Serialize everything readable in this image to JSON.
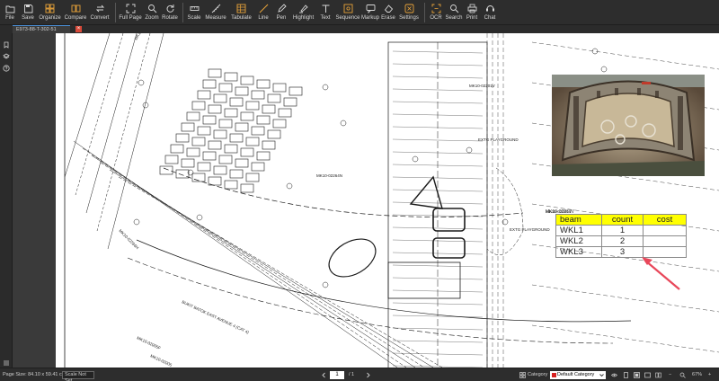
{
  "toolbar": {
    "items": [
      {
        "label": "File",
        "icon": "folder-icon"
      },
      {
        "label": "Save",
        "icon": "save-icon"
      },
      {
        "label": "Organize",
        "icon": "organize-icon"
      },
      {
        "label": "Compare",
        "icon": "compare-icon"
      },
      {
        "label": "Convert",
        "icon": "convert-icon"
      },
      {
        "label": "Full Page",
        "icon": "fullpage-icon"
      },
      {
        "label": "Zoom",
        "icon": "zoom-icon"
      },
      {
        "label": "Rotate",
        "icon": "rotate-icon"
      },
      {
        "label": "Scale",
        "icon": "scale-icon"
      },
      {
        "label": "Measure",
        "icon": "measure-icon"
      },
      {
        "label": "Tabulate",
        "icon": "tabulate-icon"
      },
      {
        "label": "Line",
        "icon": "line-icon"
      },
      {
        "label": "Pen",
        "icon": "pen-icon"
      },
      {
        "label": "Highlight",
        "icon": "highlight-icon"
      },
      {
        "label": "Text",
        "icon": "text-icon"
      },
      {
        "label": "Sequence",
        "icon": "sequence-icon"
      },
      {
        "label": "Markup",
        "icon": "markup-icon"
      },
      {
        "label": "Erase",
        "icon": "erase-icon"
      },
      {
        "label": "Settings",
        "icon": "settings-icon"
      },
      {
        "label": "OCR",
        "icon": "ocr-icon"
      },
      {
        "label": "Search",
        "icon": "search-icon"
      },
      {
        "label": "Print",
        "icon": "print-icon"
      },
      {
        "label": "Chat",
        "icon": "chat-icon"
      }
    ],
    "accent_color": "#e8a33a"
  },
  "tab": {
    "title": "E973-88-T-302-51",
    "close": "×"
  },
  "drawing": {
    "labels": [
      "MK10-02726H",
      "MK10-02266H",
      "MK10-02201V",
      "MK10-02264N",
      "BUKIT BATOK EAST AVENUE 4 (CAT 4)",
      "MK10-02005F",
      "MK10-02005",
      "EXTG PLAYGROUND",
      "EXTG PLAYGROUND",
      "MK10-02261V"
    ],
    "photo_caption": "MK10-02261V"
  },
  "table": {
    "headers": [
      "beam",
      "count",
      "cost"
    ],
    "rows": [
      [
        "WKL1",
        "1",
        ""
      ],
      [
        "WKL2",
        "2",
        ""
      ],
      [
        "WKL3",
        "3",
        ""
      ]
    ],
    "header_color": "#ffff00"
  },
  "arrow_color": "#e8475a",
  "status": {
    "page_size": "Page Size: 84.10 x 59.41 cm",
    "scale": "Scale Not Set",
    "current_page": "1",
    "total_pages": "/  1",
    "category_label": "Category",
    "category_value": "Default Category",
    "zoom": "67%"
  }
}
